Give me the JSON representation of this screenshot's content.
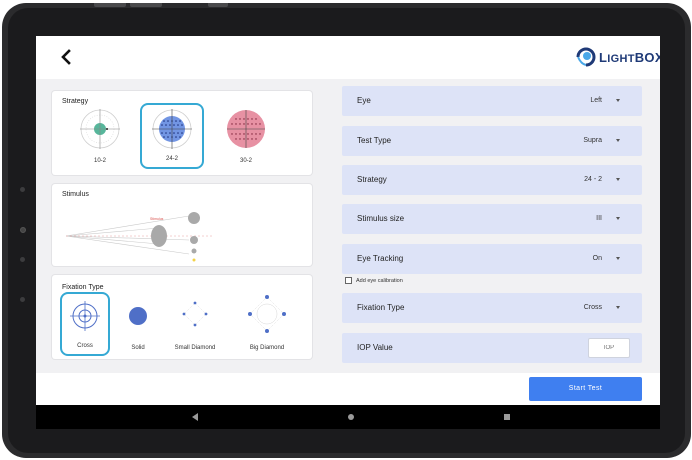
{
  "app": {
    "brand": "LightBOX",
    "brand_first": "L",
    "brand_small_1": "IGHT",
    "brand_big": "BOX"
  },
  "strategy": {
    "title": "Strategy",
    "options": [
      {
        "label": "10-2",
        "selected": false,
        "color": "#3aa98a"
      },
      {
        "label": "24-2",
        "selected": true,
        "color": "#4f7bdc"
      },
      {
        "label": "30-2",
        "selected": false,
        "color": "#e37e93"
      }
    ]
  },
  "stimulus": {
    "title": "Stimulus",
    "annotation": "Stimulus"
  },
  "fixation": {
    "title": "Fixation Type",
    "options": [
      {
        "label": "Cross",
        "selected": true
      },
      {
        "label": "Solid",
        "selected": false
      },
      {
        "label": "Small Diamond",
        "selected": false
      },
      {
        "label": "Big Diamond",
        "selected": false
      }
    ]
  },
  "settings": {
    "eye": {
      "label": "Eye",
      "value": "Left"
    },
    "test_type": {
      "label": "Test Type",
      "value": "Supra"
    },
    "strategy": {
      "label": "Strategy",
      "value": "24 - 2"
    },
    "stimulus_size": {
      "label": "Stimulus size",
      "value": "III"
    },
    "eye_tracking": {
      "label": "Eye Tracking",
      "value": "On"
    },
    "calibration": {
      "label": "Add eye calibration",
      "checked": false
    },
    "fixation_type": {
      "label": "Fixation Type",
      "value": "Cross"
    },
    "iop": {
      "label": "IOP Value",
      "placeholder": "IOP"
    }
  },
  "actions": {
    "start": "Start Test"
  },
  "colors": {
    "accent": "#3f7ff0",
    "selection": "#35a9d4",
    "row_bg": "#dde3f7"
  },
  "icons": [
    "back-arrow-icon",
    "lightbox-logo-icon",
    "dropdown-caret-icon",
    "nav-back-icon",
    "nav-home-icon",
    "nav-recents-icon"
  ]
}
